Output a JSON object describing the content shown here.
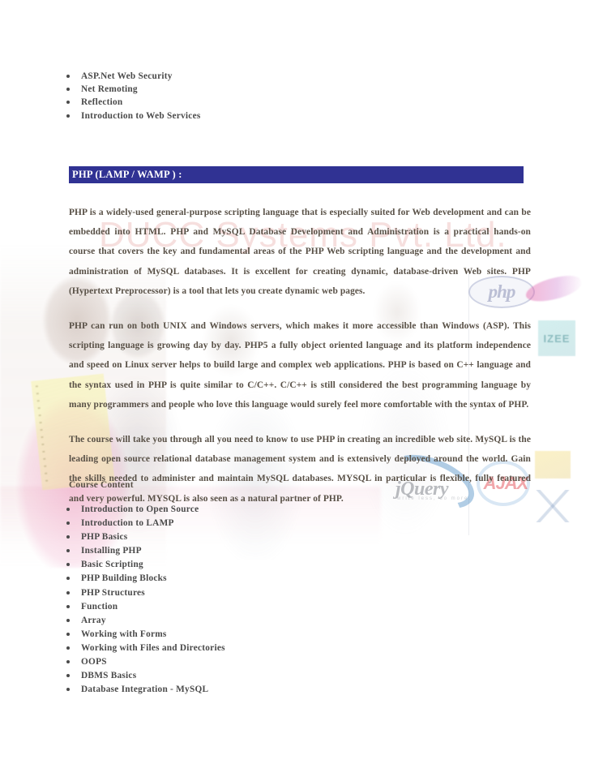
{
  "document": {
    "watermark_text": "DUCC Systems Pvt. Ltd.",
    "background_colors": {
      "page": "#ffffff",
      "header_bar": "#303293",
      "header_text": "#ffffff",
      "body_text": "#585046",
      "bullet_text": "#4a4a4a",
      "watermark": "#e29691"
    }
  },
  "top_list": {
    "items": [
      {
        "label": "ASP.Net Web Security"
      },
      {
        "label": "Net Remoting"
      },
      {
        "label": "Reflection"
      },
      {
        "label": "Introduction to Web Services"
      }
    ]
  },
  "section": {
    "heading": "PHP (LAMP / WAMP ) :",
    "paragraphs": [
      "PHP is a widely-used general-purpose scripting language that is especially suited for Web development and can be embedded into HTML. PHP and MySQL Database Development and Administration is a practical hands-on course that covers the key and fundamental areas of the PHP Web scripting language and the development and administration of MySQL databases. It is excellent for creating dynamic, database-driven Web sites. PHP (Hypertext Preprocessor) is a tool that lets you create dynamic web pages.",
      "PHP can run on both UNIX and Windows servers, which makes it more accessible than Windows (ASP). This scripting language is growing day by day. PHP5 a fully object oriented language and its platform independence and speed on Linux server helps to build large and complex web applications. PHP is based on C++ language and the syntax used in PHP is quite similar to C/C++. C/C++ is still considered the best programming language by many programmers and people who love this language would surely feel more comfortable with the syntax of PHP.",
      "The course will take you through all you need to know to use PHP in creating an incredible web site. MySQL is the leading open source relational database management system and is extensively deployed around the world. Gain the skills needed to administer and maintain MySQL databases. MYSQL in particular is flexible, fully featured and very powerful. MYSQL is also seen as a natural partner of PHP."
    ],
    "course_content_label": "Course Content",
    "course_content": [
      {
        "label": "Introduction to Open Source"
      },
      {
        "label": "Introduction to LAMP"
      },
      {
        "label": "PHP Basics"
      },
      {
        "label": "Installing PHP"
      },
      {
        "label": "Basic Scripting"
      },
      {
        "label": "PHP Building Blocks"
      },
      {
        "label": "PHP Structures"
      },
      {
        "label": "Function"
      },
      {
        "label": "Array"
      },
      {
        "label": "Working with Forms"
      },
      {
        "label": "Working with Files and Directories"
      },
      {
        "label": "OOPS"
      },
      {
        "label": "DBMS Basics"
      },
      {
        "label": "Database Integration - MySQL"
      }
    ]
  },
  "background_logos": {
    "php_logo_text": "php",
    "jquery_logo_text": "jQuery",
    "jquery_tagline": "write less, do more.",
    "ajax_logo_text": "AJAX",
    "green_box_text": "IZEE"
  }
}
